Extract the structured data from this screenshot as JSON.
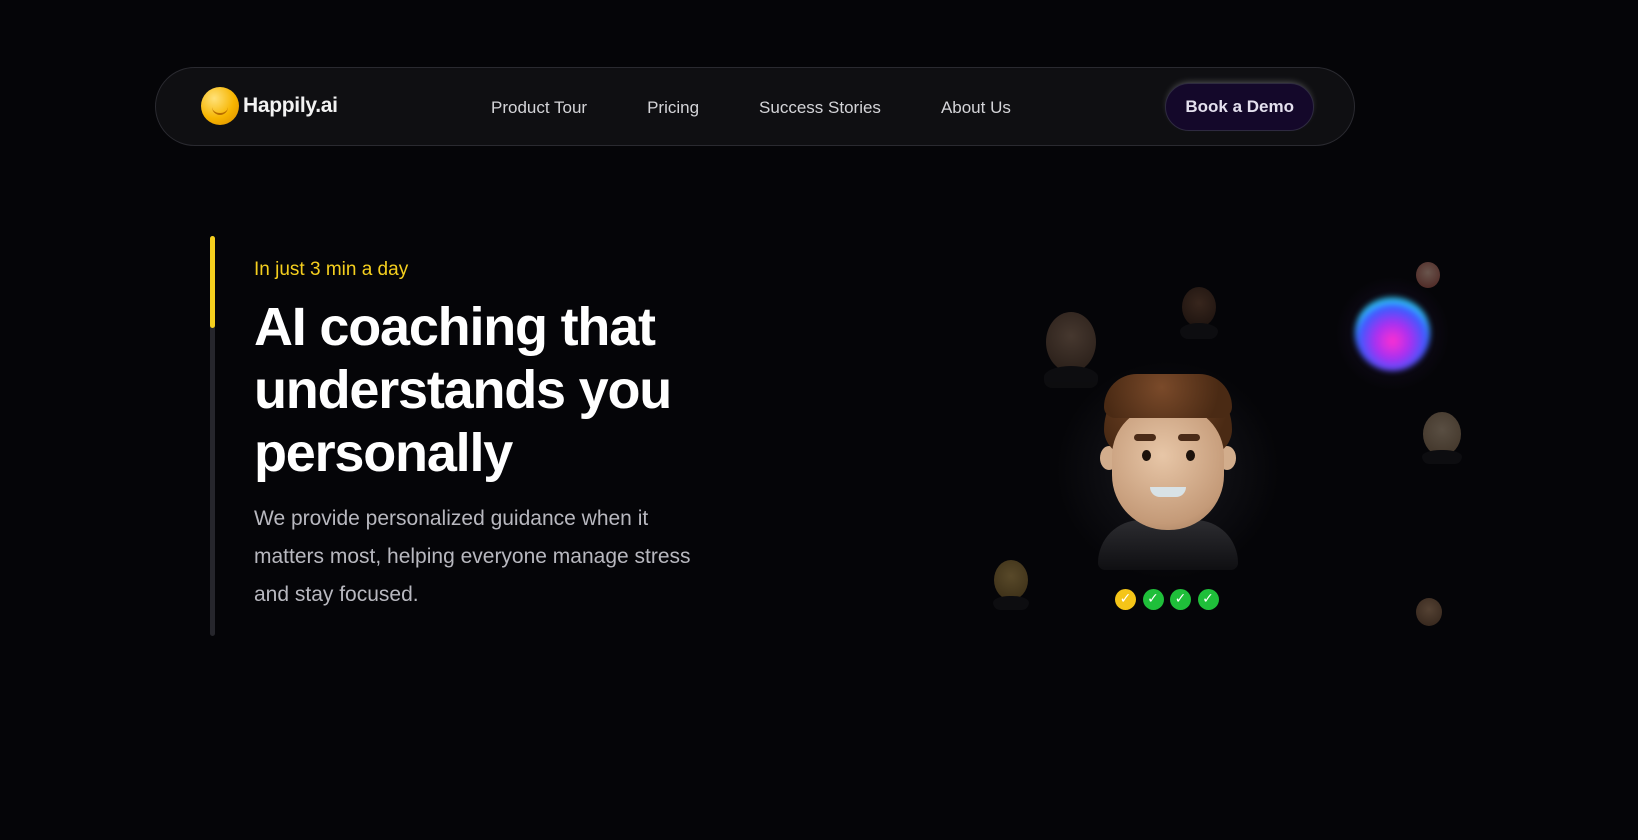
{
  "nav": {
    "logo_text": "Happily.ai",
    "links": [
      "Product Tour",
      "Pricing",
      "Success Stories",
      "About Us"
    ],
    "cta_label": "Book a Demo"
  },
  "hero": {
    "eyebrow": "In just 3 min a day",
    "headline": "AI coaching that understands you personally",
    "subtext": "We provide personalized guidance when it matters most, helping everyone manage stress and stay focused."
  },
  "avatar_panel": {
    "checks": [
      {
        "icon": "check-icon",
        "color": "#f5c518"
      },
      {
        "icon": "check-icon",
        "color": "#1fbf3a"
      },
      {
        "icon": "check-icon",
        "color": "#1fbf3a"
      },
      {
        "icon": "check-icon",
        "color": "#1fbf3a"
      }
    ]
  },
  "colors": {
    "accent_yellow": "#f5cf1e",
    "background": "#050508",
    "cta_background": "#14082a"
  }
}
